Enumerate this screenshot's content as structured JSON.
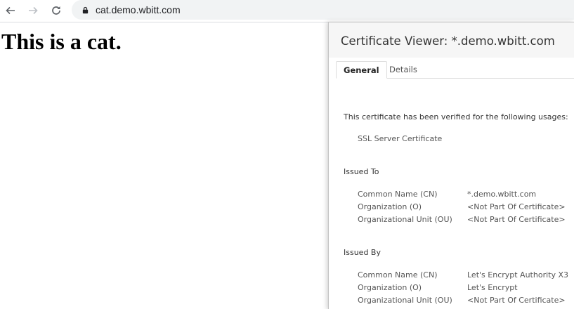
{
  "browser": {
    "back_icon": "arrow-left-icon",
    "forward_icon": "arrow-right-icon",
    "reload_icon": "reload-icon",
    "lock_icon": "lock-icon",
    "url": "cat.demo.wbitt.com"
  },
  "page": {
    "heading": "This is a cat."
  },
  "certificate_viewer": {
    "title": "Certificate Viewer: *.demo.wbitt.com",
    "tabs": [
      {
        "label": "General",
        "active": true
      },
      {
        "label": "Details",
        "active": false
      }
    ],
    "usages_heading": "This certificate has been verified for the following usages:",
    "usages": [
      "SSL Server Certificate"
    ],
    "issued_to": {
      "heading": "Issued To",
      "rows": [
        {
          "label": "Common Name (CN)",
          "value": "*.demo.wbitt.com"
        },
        {
          "label": "Organization (O)",
          "value": "<Not Part Of Certificate>"
        },
        {
          "label": "Organizational Unit (OU)",
          "value": "<Not Part Of Certificate>"
        }
      ]
    },
    "issued_by": {
      "heading": "Issued By",
      "rows": [
        {
          "label": "Common Name (CN)",
          "value": "Let's Encrypt Authority X3"
        },
        {
          "label": "Organization (O)",
          "value": "Let's Encrypt"
        },
        {
          "label": "Organizational Unit (OU)",
          "value": "<Not Part Of Certificate>"
        }
      ]
    }
  }
}
